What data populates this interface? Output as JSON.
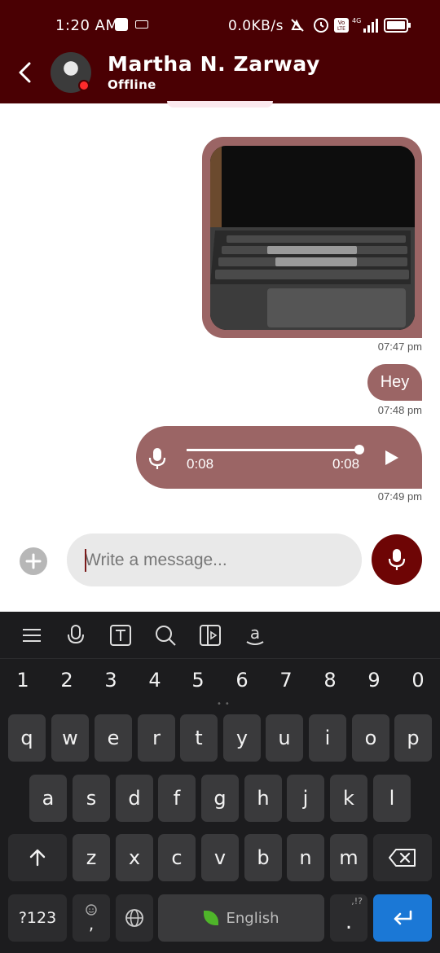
{
  "status_bar": {
    "time": "1:20 AM",
    "net_speed": "0.0KB/s",
    "network": "4G",
    "volte": "Vo LTE"
  },
  "header": {
    "contact_name": "Martha N. Zarway",
    "contact_status": "Offline"
  },
  "messages": [
    {
      "type": "image",
      "time": "07:47 pm"
    },
    {
      "type": "text",
      "text": "Hey",
      "time": "07:48 pm"
    },
    {
      "type": "audio",
      "elapsed": "0:08",
      "duration": "0:08",
      "progress": 1.0,
      "time": "07:49 pm"
    }
  ],
  "composer": {
    "placeholder": "Write a message..."
  },
  "keyboard": {
    "number_row": [
      "1",
      "2",
      "3",
      "4",
      "5",
      "6",
      "7",
      "8",
      "9",
      "0"
    ],
    "row1": [
      "q",
      "w",
      "e",
      "r",
      "t",
      "y",
      "u",
      "i",
      "o",
      "p"
    ],
    "row2": [
      "a",
      "s",
      "d",
      "f",
      "g",
      "h",
      "j",
      "k",
      "l"
    ],
    "row3": [
      "z",
      "x",
      "c",
      "v",
      "b",
      "n",
      "m"
    ],
    "symbols_key": "?123",
    "comma_key": ",",
    "space_label": "English",
    "period_key": ".",
    "period_hint": ",!?"
  },
  "colors": {
    "header_bg": "#4a0003",
    "bubble": "#9b6565",
    "mic_button": "#6e0505",
    "enter_key": "#1b78d6"
  }
}
